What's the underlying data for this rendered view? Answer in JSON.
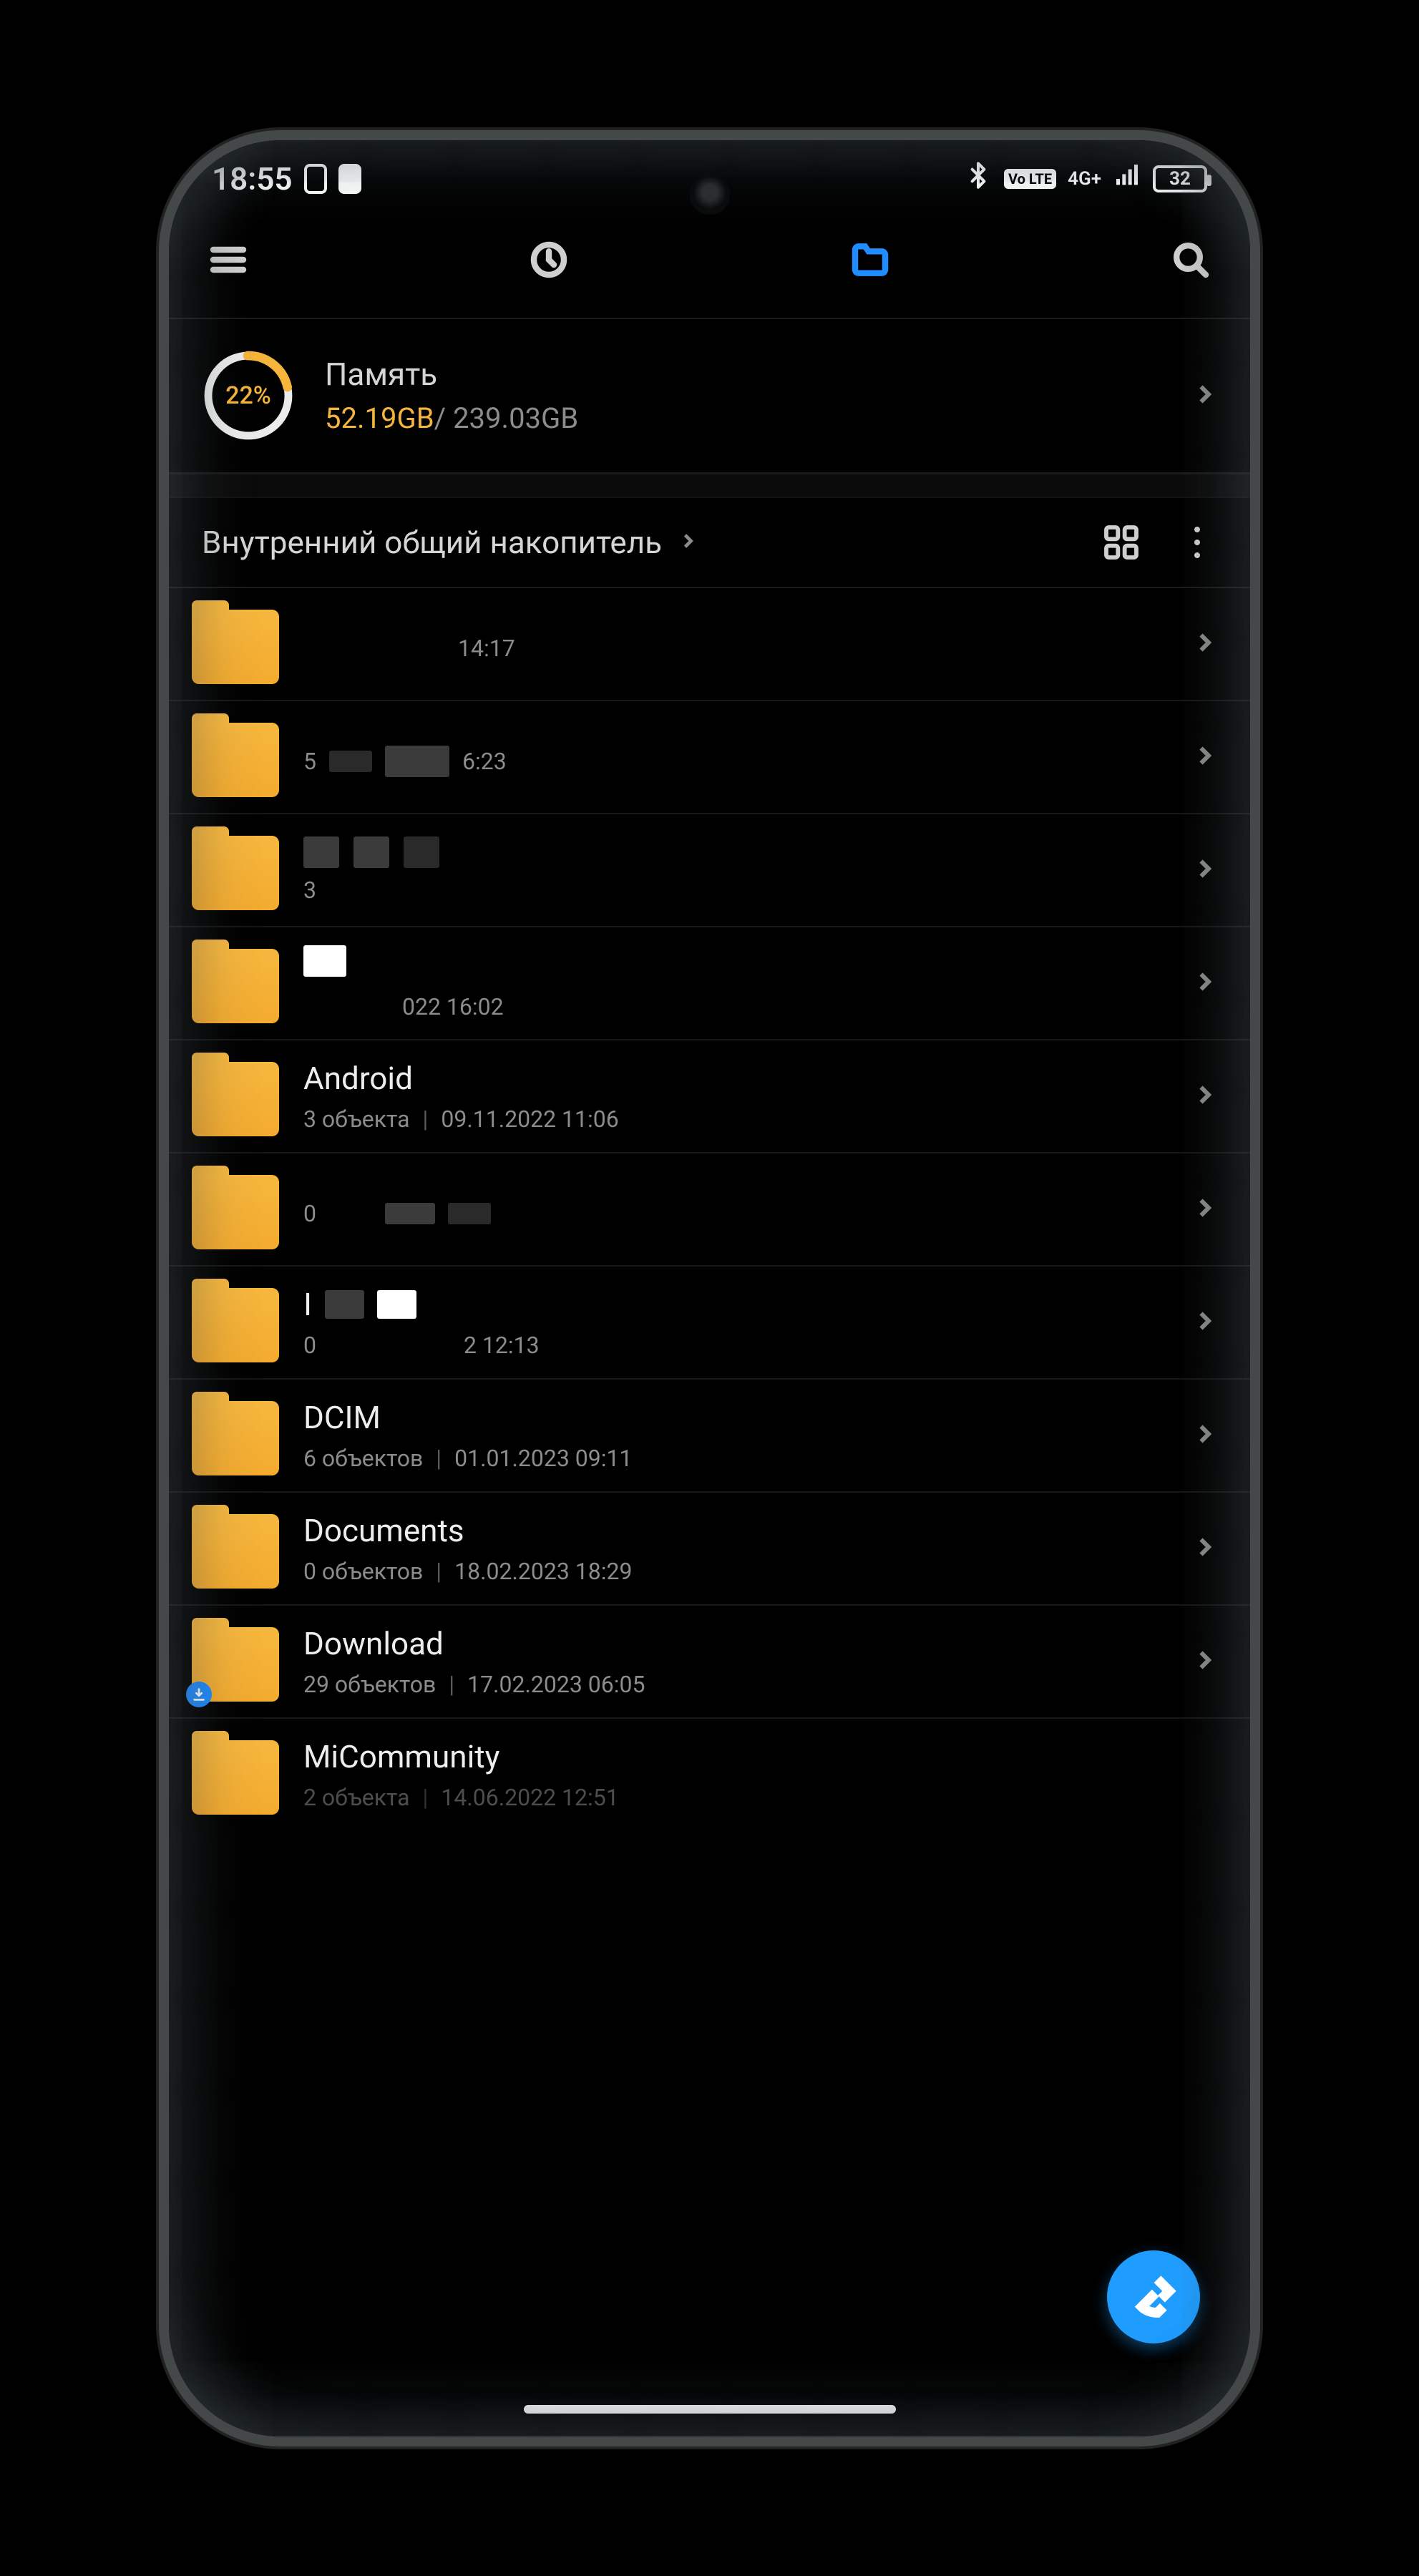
{
  "status": {
    "time": "18:55",
    "network_badge": "Vo LTE",
    "signal_label": "4G+",
    "battery_level": "32"
  },
  "storage": {
    "title": "Память",
    "percent_label": "22%",
    "used": "52.19GB",
    "separator": "/",
    "total": " 239.03GB"
  },
  "breadcrumb": {
    "label": "Внутренний общий накопитель"
  },
  "rows": [
    {
      "title": "",
      "count": "",
      "date": "14:17",
      "badge": null
    },
    {
      "title": "",
      "count": "5",
      "date": "6:23",
      "badge": null
    },
    {
      "title": "",
      "count": "3",
      "date": "",
      "badge": null
    },
    {
      "title": "",
      "count": "",
      "date": "022 16:02",
      "badge": null
    },
    {
      "title": "Android",
      "count": "3 объекта",
      "date": "09.11.2022 11:06",
      "badge": null
    },
    {
      "title": "",
      "count": "0",
      "date": "",
      "badge": null
    },
    {
      "title": "",
      "count": "0",
      "date": "2 12:13",
      "badge": null
    },
    {
      "title": "DCIM",
      "count": "6 объектов",
      "date": "01.01.2023 09:11",
      "badge": null
    },
    {
      "title": "Documents",
      "count": "0 объектов",
      "date": "18.02.2023 18:29",
      "badge": null
    },
    {
      "title": "Download",
      "count": "29 объектов",
      "date": "17.02.2023 06:05",
      "badge": "download"
    },
    {
      "title": "MiCommunity",
      "count": "2 объекта",
      "date": "14.06.2022 12:51",
      "badge": null
    }
  ]
}
